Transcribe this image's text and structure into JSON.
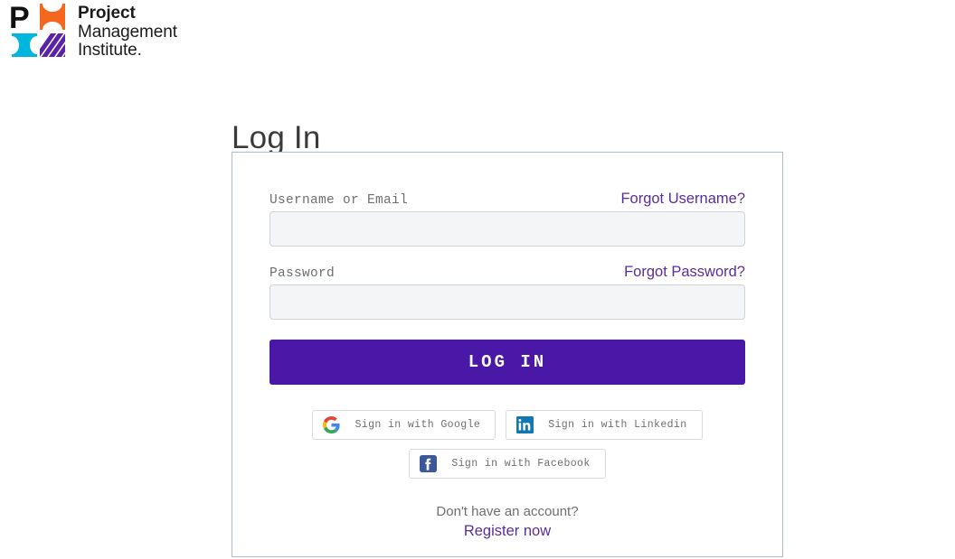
{
  "brand": {
    "logo_icon": "pmi-logo-icon",
    "name_lines": [
      "Project",
      "Management",
      "Institute."
    ],
    "colors": {
      "black": "#111111",
      "orange": "#F5661E",
      "cyan": "#00B6DE",
      "purple": "#5B21A8"
    }
  },
  "page": {
    "title": "Log In"
  },
  "form": {
    "username": {
      "label": "Username or Email",
      "value": "",
      "placeholder": "",
      "forgot_link": "Forgot Username?"
    },
    "password": {
      "label": "Password",
      "value": "",
      "placeholder": "",
      "forgot_link": "Forgot Password?"
    },
    "submit_label": "LOG IN",
    "submit_color": "#4A18A7"
  },
  "social": [
    {
      "provider": "google",
      "icon": "google-icon",
      "label": "Sign in with Google"
    },
    {
      "provider": "linkedin",
      "icon": "linkedin-icon",
      "label": "Sign in with Linkedin"
    },
    {
      "provider": "facebook",
      "icon": "facebook-icon",
      "label": "Sign in with Facebook"
    }
  ],
  "register": {
    "question": "Don't have an account?",
    "link": "Register now"
  },
  "link_color": "#5B2D9B"
}
